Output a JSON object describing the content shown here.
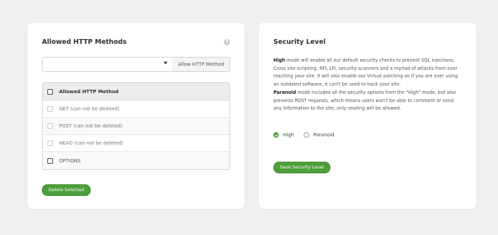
{
  "methods_card": {
    "title": "Allowed HTTP Methods",
    "help_icon": "?",
    "select_value": "",
    "allow_button": "Allow HTTP Method",
    "table_header": "Allowed HTTP Method",
    "rows": [
      {
        "label": "GET (can not be deleted)",
        "disabled": true
      },
      {
        "label": "POST (can not be deleted)",
        "disabled": true
      },
      {
        "label": "HEAD (can not be deleted)",
        "disabled": true
      },
      {
        "label": "OPTIONS",
        "disabled": false
      }
    ],
    "delete_button": "Delete Selected"
  },
  "security_card": {
    "title": "Security Level",
    "high_term": "High",
    "high_text": " mode will enable all our default security checks to prevent SQL injections, Cross site scripting, RFI, LFI, security scanners and a myriad of attacks from ever reaching your site. It will also enable our Virtual patching so if you are ever using an outdated software, it can't be used to hack your site.",
    "paranoid_term": "Paranoid",
    "paranoid_text": " mode includes all the security options from the \"High\" mode, but also prevents POST requests, which means users won't be able to comment or send any information to the site, only reading will be allowed.",
    "options": [
      {
        "label": "High",
        "checked": true
      },
      {
        "label": "Paranoid",
        "checked": false
      }
    ],
    "save_button": "Save Security Level"
  },
  "colors": {
    "accent_green": "#4e9e3c",
    "background": "#f0f0f0"
  }
}
